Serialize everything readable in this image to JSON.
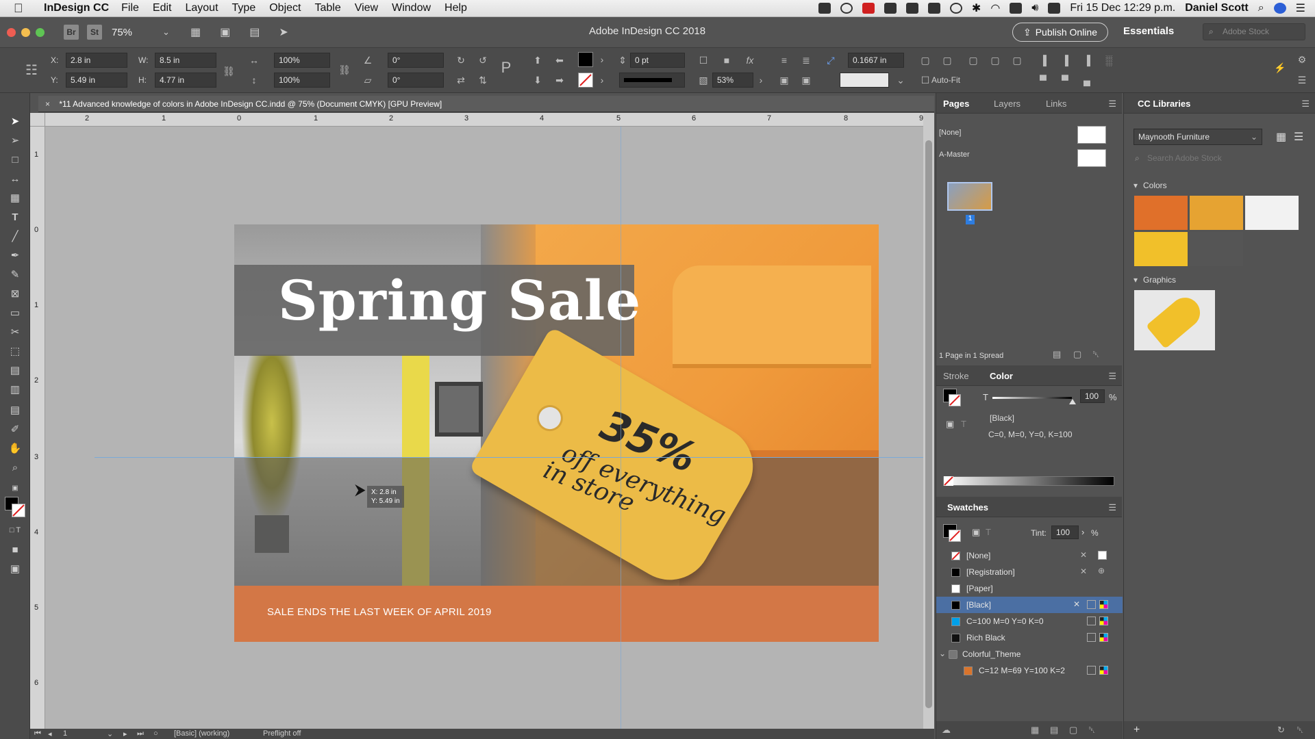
{
  "menubar": {
    "app_name": "InDesign CC",
    "items": [
      "File",
      "Edit",
      "Layout",
      "Type",
      "Object",
      "Table",
      "View",
      "Window",
      "Help"
    ],
    "datetime": "Fri 15 Dec  12:29 p.m.",
    "user": "Daniel Scott"
  },
  "appbar": {
    "br": "Br",
    "st": "St",
    "zoom": "75%",
    "title": "Adobe InDesign CC 2018",
    "publish": "Publish Online",
    "workspace": "Essentials",
    "stock_placeholder": "Adobe Stock"
  },
  "control": {
    "x_label": "X:",
    "x": "2.8 in",
    "y_label": "Y:",
    "y": "5.49 in",
    "w_label": "W:",
    "w": "8.5 in",
    "h_label": "H:",
    "h": "4.77 in",
    "scale_x": "100%",
    "scale_y": "100%",
    "rotate": "0°",
    "shear": "0°",
    "stroke_weight": "0 pt",
    "opacity": "53%",
    "gap": "0.1667 in",
    "autofit": "Auto-Fit"
  },
  "doc_tab": {
    "close": "×",
    "title": "*11 Advanced knowledge of colors in Adobe InDesign CC.indd @ 75% (Document CMYK) [GPU Preview]"
  },
  "rulers": {
    "top": [
      "2",
      "1",
      "0",
      "1",
      "2",
      "3",
      "4",
      "5",
      "6",
      "7",
      "8",
      "9"
    ],
    "left": [
      "1",
      "0",
      "1",
      "2",
      "3",
      "4",
      "5",
      "6"
    ]
  },
  "artwork": {
    "title": "Spring Sale",
    "tag_pct": "35%",
    "tag_line2": "off everything",
    "tag_line3": "in store",
    "footer": "SALE ENDS THE LAST WEEK OF APRIL 2019"
  },
  "cursor_tip": {
    "x": "X: 2.8 in",
    "y": "Y: 5.49 in"
  },
  "status": {
    "page": "1",
    "style": "[Basic] (working)",
    "preflight": "Preflight off"
  },
  "pages_panel": {
    "tabs": [
      "Pages",
      "Layers",
      "Links"
    ],
    "none": "[None]",
    "master": "A-Master",
    "page_num": "1",
    "footer": "1 Page in 1 Spread"
  },
  "color_panel": {
    "tabs": [
      "Stroke",
      "Color"
    ],
    "tint_label": "T",
    "tint": "100",
    "pct": "%",
    "swatch": "[Black]",
    "cmyk": "C=0, M=0, Y=0, K=100"
  },
  "swatches_panel": {
    "title": "Swatches",
    "tint_label": "Tint:",
    "tint": "100",
    "pct": "%",
    "items": [
      {
        "name": "[None]",
        "color": "none"
      },
      {
        "name": "[Registration]",
        "color": "#000000"
      },
      {
        "name": "[Paper]",
        "color": "#ffffff"
      },
      {
        "name": "[Black]",
        "color": "#000000"
      },
      {
        "name": "C=100 M=0 Y=0 K=0",
        "color": "#00a0e9"
      },
      {
        "name": "Rich Black",
        "color": "#111111"
      },
      {
        "name": "Colorful_Theme",
        "color": "folder"
      },
      {
        "name": "C=12 M=69 Y=100 K=2",
        "color": "#d9742c"
      }
    ]
  },
  "libraries": {
    "title": "CC Libraries",
    "library": "Maynooth Furniture",
    "search_placeholder": "Search Adobe Stock",
    "colors_heading": "Colors",
    "colors": [
      "#e0702a",
      "#e6a332",
      "#f2f2f2",
      "#f1c02a",
      "#555555"
    ],
    "graphics_heading": "Graphics"
  }
}
